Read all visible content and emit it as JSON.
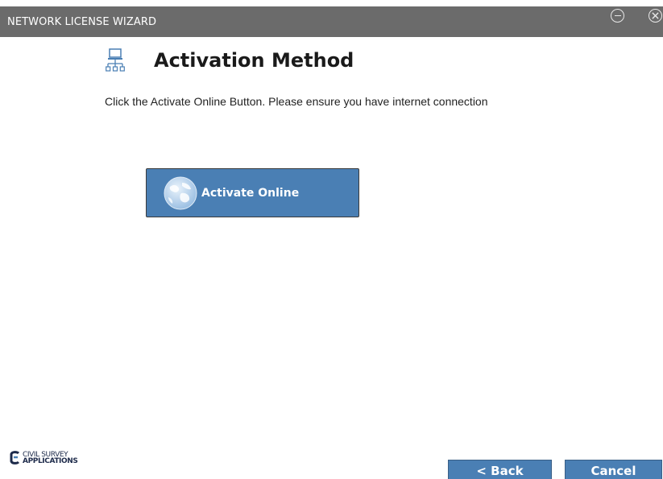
{
  "window": {
    "title": "NETWORK LICENSE WIZARD"
  },
  "page": {
    "title": "Activation Method",
    "instruction": "Click the Activate Online Button. Please ensure you have internet connection",
    "icon": "network-computer-icon"
  },
  "activate": {
    "label": "Activate Online",
    "icon": "globe-icon"
  },
  "logo": {
    "line1": "CIVIL SURVEY",
    "line2": "APPLICATIONS"
  },
  "footer": {
    "back_label": "< Back",
    "cancel_label": "Cancel"
  },
  "colors": {
    "titlebar": "#6b6b6b",
    "button": "#4a7fb4"
  }
}
